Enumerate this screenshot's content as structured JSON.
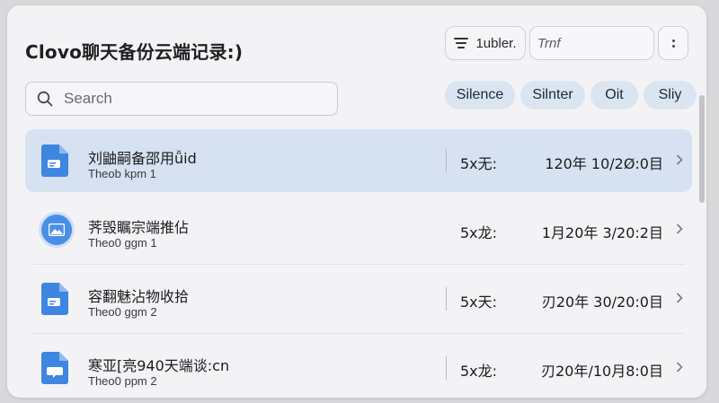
{
  "header": {
    "title": "Clovo聊天备份云端记录:)",
    "filter_label": "1ubler.",
    "filter_icon": "filter-lines-icon",
    "text_field_value": "Trnf",
    "more_icon": "more-vertical-icon"
  },
  "search": {
    "placeholder": "Search",
    "icon": "search-icon"
  },
  "chips": [
    "Silence",
    "Silnter",
    "Oit",
    "Sliy"
  ],
  "rows": [
    {
      "name": "刘鼬嗣备邵用ǚid",
      "sub": "Theob kpm 1",
      "count": "5x无:",
      "date": "120年 10/2Ø:0目",
      "icon": "document-icon",
      "selected": true
    },
    {
      "name": "荠毁瞩宗端推佔",
      "sub": "Theo0 ggm 1",
      "count": "5x龙:",
      "date": "1月20年 3/20:2目",
      "icon": "image-icon",
      "selected": false
    },
    {
      "name": "容翻魅沾物收拾",
      "sub": "Theo0 ggm 2",
      "count": "5x天:",
      "date": "刃20年 30/20:0目",
      "icon": "document-icon",
      "selected": false
    },
    {
      "name": "寒亚[亮940天端谈:cn",
      "sub": "Theo0 ppm 2",
      "count": "5x龙:",
      "date": "刃20年/10月8:0目",
      "icon": "chat-document-icon",
      "selected": false
    }
  ],
  "colors": {
    "accent": "#3f86e0",
    "selected_row": "#d6e2f1",
    "chip": "#dbe5f2"
  }
}
